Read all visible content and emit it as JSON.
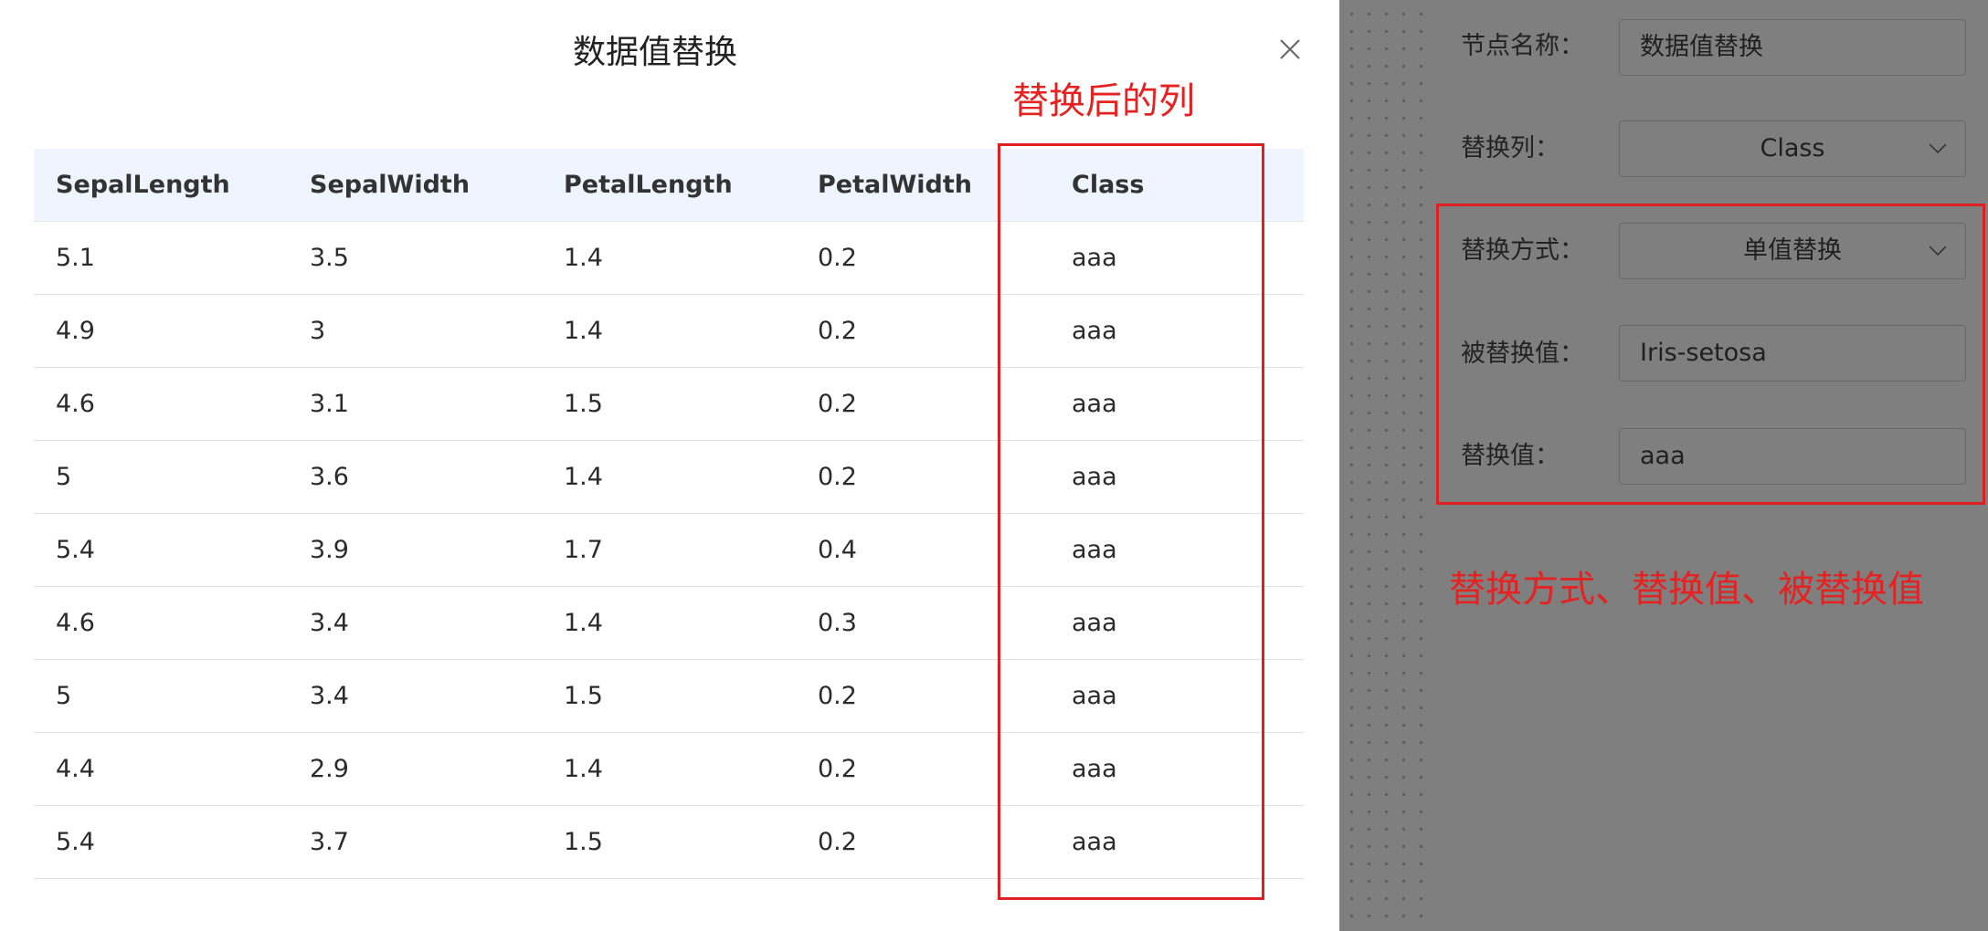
{
  "modal": {
    "title": "数据值替换",
    "columns": [
      "SepalLength",
      "SepalWidth",
      "PetalLength",
      "PetalWidth",
      "Class"
    ],
    "rows": [
      [
        "5.1",
        "3.5",
        "1.4",
        "0.2",
        "aaa"
      ],
      [
        "4.9",
        "3",
        "1.4",
        "0.2",
        "aaa"
      ],
      [
        "4.6",
        "3.1",
        "1.5",
        "0.2",
        "aaa"
      ],
      [
        "5",
        "3.6",
        "1.4",
        "0.2",
        "aaa"
      ],
      [
        "5.4",
        "3.9",
        "1.7",
        "0.4",
        "aaa"
      ],
      [
        "4.6",
        "3.4",
        "1.4",
        "0.3",
        "aaa"
      ],
      [
        "5",
        "3.4",
        "1.5",
        "0.2",
        "aaa"
      ],
      [
        "4.4",
        "2.9",
        "1.4",
        "0.2",
        "aaa"
      ],
      [
        "5.4",
        "3.7",
        "1.5",
        "0.2",
        "aaa"
      ]
    ]
  },
  "annotations": {
    "column_note": "替换后的列",
    "fields_note": "替换方式、替换值、被替换值",
    "color": "#e02020"
  },
  "form": {
    "node_name_label": "节点名称：",
    "node_name_value": "数据值替换",
    "replace_column_label": "替换列：",
    "replace_column_value": "Class",
    "replace_mode_label": "替换方式：",
    "replace_mode_value": "单值替换",
    "replaced_value_label": "被替换值：",
    "replaced_value_value": "Iris-setosa",
    "new_value_label": "替换值：",
    "new_value_value": "aaa"
  },
  "icons": {
    "close": "close-icon",
    "dropdown": "chevron-down-icon"
  }
}
